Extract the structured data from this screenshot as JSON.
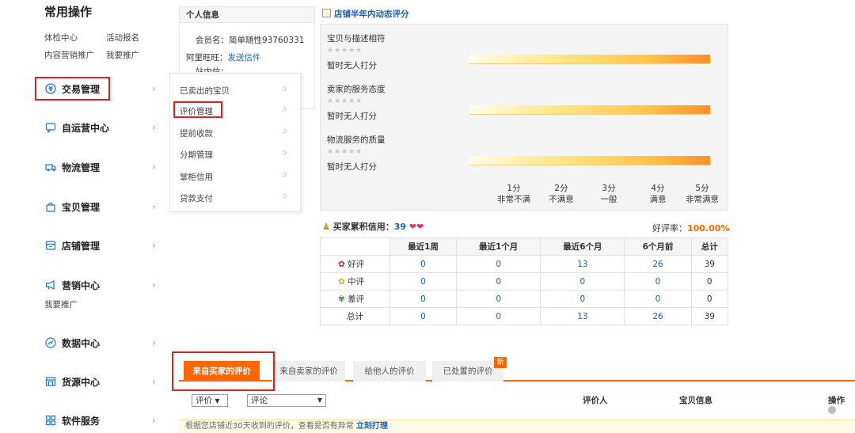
{
  "sidebar": {
    "title": "常用操作",
    "quick_links": [
      "体检中心",
      "活动报名",
      "内容营销推广",
      "我要推广"
    ],
    "nav": [
      {
        "label": "交易管理",
        "icon": "yen-circle-icon"
      },
      {
        "label": "自运营中心",
        "icon": "chat-icon"
      },
      {
        "label": "物流管理",
        "icon": "truck-icon"
      },
      {
        "label": "宝贝管理",
        "icon": "bag-icon"
      },
      {
        "label": "店铺管理",
        "icon": "shop-icon"
      },
      {
        "label": "营销中心",
        "icon": "megaphone-icon"
      },
      {
        "label": "数据中心",
        "icon": "chart-circle-icon"
      },
      {
        "label": "货源中心",
        "icon": "store-icon"
      },
      {
        "label": "软件服务",
        "icon": "apps-grid-icon"
      }
    ],
    "marketing_sub": "我要推广",
    "chevron": "›"
  },
  "submenu": {
    "items": [
      "已卖出的宝贝",
      "评价管理",
      "提前收款",
      "分期管理",
      "掌柜信用",
      "贷款支付"
    ]
  },
  "info": {
    "title": "个人信息",
    "member_label": "会员名：",
    "member_value": "简单随性93760331",
    "wangwang_label": "阿里旺旺：",
    "wangwang_link": "发送信件",
    "station_label": "站内信："
  },
  "dsr": {
    "title": "店铺半年内动态评分",
    "items": [
      {
        "label": "宝贝与描述相符",
        "stars": "★★★★★",
        "note": "暂时无人打分"
      },
      {
        "label": "卖家的服务态度",
        "stars": "★★★★★",
        "note": "暂时无人打分"
      },
      {
        "label": "物流服务的质量",
        "stars": "★★★★★",
        "note": "暂时无人打分"
      }
    ],
    "scale": [
      {
        "score": "1分",
        "desc": "非常不满"
      },
      {
        "score": "2分",
        "desc": "不满意"
      },
      {
        "score": "3分",
        "desc": "一般"
      },
      {
        "score": "4分",
        "desc": "满意"
      },
      {
        "score": "5分",
        "desc": "非常满意"
      }
    ]
  },
  "credit": {
    "label": "买家累积信用：",
    "value": "39",
    "rate_label": "好评率：",
    "rate_value": "100.00%",
    "headers": [
      "",
      "最近1周",
      "最近1个月",
      "最近6个月",
      "6个月前",
      "总计"
    ],
    "rows": [
      {
        "label": "好评",
        "values": [
          "0",
          "0",
          "13",
          "26",
          "39"
        ]
      },
      {
        "label": "中评",
        "values": [
          "0",
          "0",
          "0",
          "0",
          "0"
        ]
      },
      {
        "label": "差评",
        "values": [
          "0",
          "0",
          "0",
          "0",
          "0"
        ]
      },
      {
        "label": "总计",
        "values": [
          "0",
          "0",
          "13",
          "26",
          "39"
        ]
      }
    ]
  },
  "tabs": [
    "来自买家的评价",
    "来自卖家的评价",
    "给他人的评价",
    "已处置的评价"
  ],
  "new_badge": "新",
  "filters": {
    "rating": "评价",
    "comment": "评论"
  },
  "columns": {
    "rater": "评价人",
    "item": "宝贝信息",
    "action": "操作"
  },
  "tip": {
    "text": "根据您店铺近30天收到的评价，查看是否有异常",
    "link": "立刻打理"
  }
}
